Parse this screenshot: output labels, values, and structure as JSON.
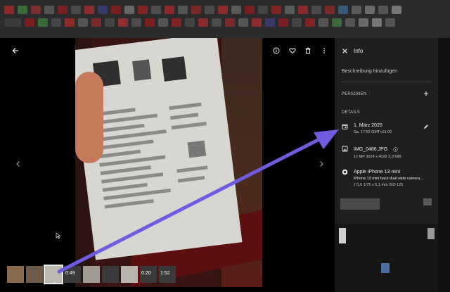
{
  "viewer": {
    "back_icon": "arrow-left-icon",
    "prev_icon": "chevron-left-icon",
    "next_icon": "chevron-right-icon",
    "toolbar_icons": [
      "info-icon",
      "heart-icon",
      "trash-icon",
      "more-vert-icon"
    ],
    "thumbnail_labels": [
      "0:49",
      "0:20",
      "1:52"
    ]
  },
  "info_panel": {
    "close_icon": "close-icon",
    "title": "Info",
    "description_placeholder": "Beschreibung hinzufügen",
    "persons_header": "PERSONEN",
    "details_header": "DETAILS",
    "date": "1. März 2025",
    "date_sub": "Sa, 17:52 GMT+01:00",
    "file_name": "IMG_0486.JPG",
    "file_sub": "12 MP   3024 x 4032   3,3 MiB",
    "camera": "Apple iPhone 13 mini",
    "camera_lens": "iPhone 13 mini back dual wide camera...",
    "camera_sub": "ƒ/1,6   1/75 s   5,1 mm   ISO 125"
  },
  "colors": {
    "arrow": "#6f5ce0",
    "panel_bg": "#1f1f1f",
    "viewer_bg": "#000000"
  }
}
